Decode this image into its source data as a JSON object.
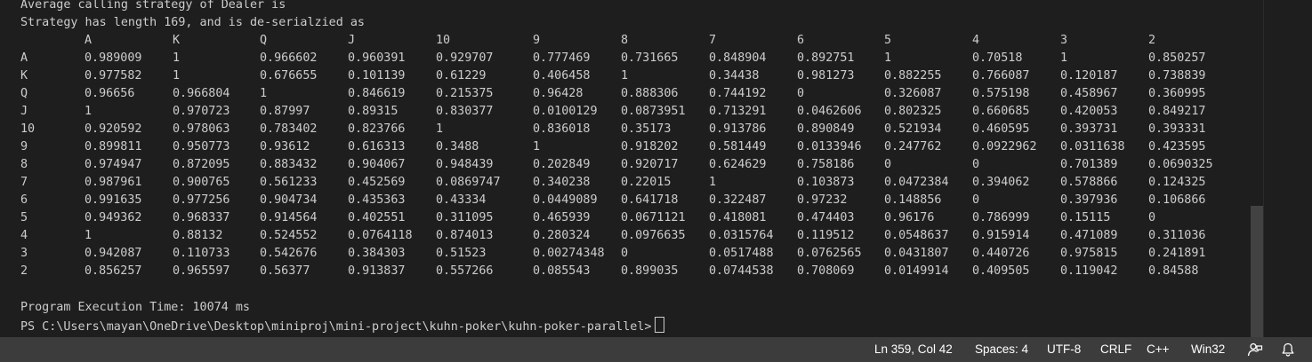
{
  "terminal": {
    "header_lines": [
      "Average calling strategy of Dealer is",
      "Strategy has length 169, and is de-serialzied as"
    ],
    "table": {
      "columns": [
        "A",
        "K",
        "Q",
        "J",
        "10",
        "9",
        "8",
        "7",
        "6",
        "5",
        "4",
        "3",
        "2"
      ],
      "rows": [
        {
          "label": "A",
          "values": [
            "0.989009",
            "1",
            "0.966602",
            "0.960391",
            "0.929707",
            "0.777469",
            "0.731665",
            "0.848904",
            "0.892751",
            "1",
            "0.70518",
            "1",
            "0.850257"
          ]
        },
        {
          "label": "K",
          "values": [
            "0.977582",
            "1",
            "0.676655",
            "0.101139",
            "0.61229",
            "0.406458",
            "1",
            "0.34438",
            "0.981273",
            "0.882255",
            "0.766087",
            "0.120187",
            "0.738839"
          ]
        },
        {
          "label": "Q",
          "values": [
            "0.96656",
            "0.966804",
            "1",
            "0.846619",
            "0.215375",
            "0.96428",
            "0.888306",
            "0.744192",
            "0",
            "0.326087",
            "0.575198",
            "0.458967",
            "0.360995"
          ]
        },
        {
          "label": "J",
          "values": [
            "1",
            "0.970723",
            "0.87997",
            "0.89315",
            "0.830377",
            "0.0100129",
            "0.0873951",
            "0.713291",
            "0.0462606",
            "0.802325",
            "0.660685",
            "0.420053",
            "0.849217"
          ]
        },
        {
          "label": "10",
          "values": [
            "0.920592",
            "0.978063",
            "0.783402",
            "0.823766",
            "1",
            "0.836018",
            "0.35173",
            "0.913786",
            "0.890849",
            "0.521934",
            "0.460595",
            "0.393731",
            "0.393331"
          ]
        },
        {
          "label": "9",
          "values": [
            "0.899811",
            "0.950773",
            "0.93612",
            "0.616313",
            "0.3488",
            "1",
            "0.918202",
            "0.581449",
            "0.0133946",
            "0.247762",
            "0.0922962",
            "0.0311638",
            "0.423595"
          ]
        },
        {
          "label": "8",
          "values": [
            "0.974947",
            "0.872095",
            "0.883432",
            "0.904067",
            "0.948439",
            "0.202849",
            "0.920717",
            "0.624629",
            "0.758186",
            "0",
            "0",
            "0.701389",
            "0.0690325"
          ]
        },
        {
          "label": "7",
          "values": [
            "0.987961",
            "0.900765",
            "0.561233",
            "0.452569",
            "0.0869747",
            "0.340238",
            "0.22015",
            "1",
            "0.103873",
            "0.0472384",
            "0.394062",
            "0.578866",
            "0.124325"
          ]
        },
        {
          "label": "6",
          "values": [
            "0.991635",
            "0.977256",
            "0.904734",
            "0.435363",
            "0.43334",
            "0.0449089",
            "0.641718",
            "0.322487",
            "0.97232",
            "0.148856",
            "0",
            "0.397936",
            "0.106866"
          ]
        },
        {
          "label": "5",
          "values": [
            "0.949362",
            "0.968337",
            "0.914564",
            "0.402551",
            "0.311095",
            "0.465939",
            "0.0671121",
            "0.418081",
            "0.474403",
            "0.96176",
            "0.786999",
            "0.15115",
            "0"
          ]
        },
        {
          "label": "4",
          "values": [
            "1",
            "0.88132",
            "0.524552",
            "0.0764118",
            "0.874013",
            "0.280324",
            "0.0976635",
            "0.0315764",
            "0.119512",
            "0.0548637",
            "0.915914",
            "0.471089",
            "0.311036"
          ]
        },
        {
          "label": "3",
          "values": [
            "0.942087",
            "0.110733",
            "0.542676",
            "0.384303",
            "0.51523",
            "0.00274348",
            "0",
            "0.0517488",
            "0.0762565",
            "0.0431807",
            "0.440726",
            "0.975815",
            "0.241891"
          ]
        },
        {
          "label": "2",
          "values": [
            "0.856257",
            "0.965597",
            "0.56377",
            "0.913837",
            "0.557266",
            "0.085543",
            "0.899035",
            "0.0744538",
            "0.708069",
            "0.0149914",
            "0.409505",
            "0.119042",
            "0.84588"
          ]
        }
      ]
    },
    "execution_time": "Program Execution Time: 10074 ms",
    "prompt": "PS C:\\Users\\mayan\\OneDrive\\Desktop\\miniproj\\mini-project\\kuhn-poker\\kuhn-poker-parallel>"
  },
  "statusbar": {
    "position": "Ln 359, Col 42",
    "indentation": "Spaces: 4",
    "encoding": "UTF-8",
    "line_ending": "CRLF",
    "language": "C++",
    "platform": "Win32",
    "icons": [
      "feedback-person-icon",
      "notification-bell-icon"
    ]
  },
  "colors": {
    "terminal_background": "#1e1e1e",
    "terminal_text": "#cccccc",
    "statusbar_background": "#3c3c3c",
    "statusbar_text": "#ffffff",
    "scrollbar_thumb": "#424242"
  }
}
